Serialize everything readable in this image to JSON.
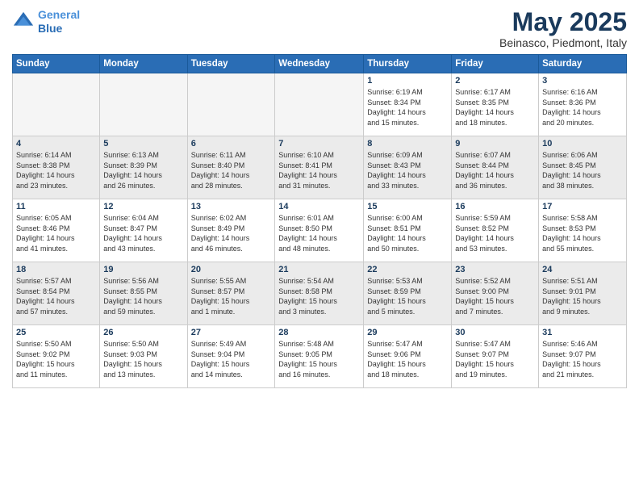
{
  "header": {
    "logo_line1": "General",
    "logo_line2": "Blue",
    "title": "May 2025",
    "subtitle": "Beinasco, Piedmont, Italy"
  },
  "weekdays": [
    "Sunday",
    "Monday",
    "Tuesday",
    "Wednesday",
    "Thursday",
    "Friday",
    "Saturday"
  ],
  "weeks": [
    [
      {
        "day": "",
        "info": "",
        "empty": true
      },
      {
        "day": "",
        "info": "",
        "empty": true
      },
      {
        "day": "",
        "info": "",
        "empty": true
      },
      {
        "day": "",
        "info": "",
        "empty": true
      },
      {
        "day": "1",
        "info": "Sunrise: 6:19 AM\nSunset: 8:34 PM\nDaylight: 14 hours\nand 15 minutes."
      },
      {
        "day": "2",
        "info": "Sunrise: 6:17 AM\nSunset: 8:35 PM\nDaylight: 14 hours\nand 18 minutes."
      },
      {
        "day": "3",
        "info": "Sunrise: 6:16 AM\nSunset: 8:36 PM\nDaylight: 14 hours\nand 20 minutes."
      }
    ],
    [
      {
        "day": "4",
        "info": "Sunrise: 6:14 AM\nSunset: 8:38 PM\nDaylight: 14 hours\nand 23 minutes."
      },
      {
        "day": "5",
        "info": "Sunrise: 6:13 AM\nSunset: 8:39 PM\nDaylight: 14 hours\nand 26 minutes."
      },
      {
        "day": "6",
        "info": "Sunrise: 6:11 AM\nSunset: 8:40 PM\nDaylight: 14 hours\nand 28 minutes."
      },
      {
        "day": "7",
        "info": "Sunrise: 6:10 AM\nSunset: 8:41 PM\nDaylight: 14 hours\nand 31 minutes."
      },
      {
        "day": "8",
        "info": "Sunrise: 6:09 AM\nSunset: 8:43 PM\nDaylight: 14 hours\nand 33 minutes."
      },
      {
        "day": "9",
        "info": "Sunrise: 6:07 AM\nSunset: 8:44 PM\nDaylight: 14 hours\nand 36 minutes."
      },
      {
        "day": "10",
        "info": "Sunrise: 6:06 AM\nSunset: 8:45 PM\nDaylight: 14 hours\nand 38 minutes."
      }
    ],
    [
      {
        "day": "11",
        "info": "Sunrise: 6:05 AM\nSunset: 8:46 PM\nDaylight: 14 hours\nand 41 minutes."
      },
      {
        "day": "12",
        "info": "Sunrise: 6:04 AM\nSunset: 8:47 PM\nDaylight: 14 hours\nand 43 minutes."
      },
      {
        "day": "13",
        "info": "Sunrise: 6:02 AM\nSunset: 8:49 PM\nDaylight: 14 hours\nand 46 minutes."
      },
      {
        "day": "14",
        "info": "Sunrise: 6:01 AM\nSunset: 8:50 PM\nDaylight: 14 hours\nand 48 minutes."
      },
      {
        "day": "15",
        "info": "Sunrise: 6:00 AM\nSunset: 8:51 PM\nDaylight: 14 hours\nand 50 minutes."
      },
      {
        "day": "16",
        "info": "Sunrise: 5:59 AM\nSunset: 8:52 PM\nDaylight: 14 hours\nand 53 minutes."
      },
      {
        "day": "17",
        "info": "Sunrise: 5:58 AM\nSunset: 8:53 PM\nDaylight: 14 hours\nand 55 minutes."
      }
    ],
    [
      {
        "day": "18",
        "info": "Sunrise: 5:57 AM\nSunset: 8:54 PM\nDaylight: 14 hours\nand 57 minutes."
      },
      {
        "day": "19",
        "info": "Sunrise: 5:56 AM\nSunset: 8:55 PM\nDaylight: 14 hours\nand 59 minutes."
      },
      {
        "day": "20",
        "info": "Sunrise: 5:55 AM\nSunset: 8:57 PM\nDaylight: 15 hours\nand 1 minute."
      },
      {
        "day": "21",
        "info": "Sunrise: 5:54 AM\nSunset: 8:58 PM\nDaylight: 15 hours\nand 3 minutes."
      },
      {
        "day": "22",
        "info": "Sunrise: 5:53 AM\nSunset: 8:59 PM\nDaylight: 15 hours\nand 5 minutes."
      },
      {
        "day": "23",
        "info": "Sunrise: 5:52 AM\nSunset: 9:00 PM\nDaylight: 15 hours\nand 7 minutes."
      },
      {
        "day": "24",
        "info": "Sunrise: 5:51 AM\nSunset: 9:01 PM\nDaylight: 15 hours\nand 9 minutes."
      }
    ],
    [
      {
        "day": "25",
        "info": "Sunrise: 5:50 AM\nSunset: 9:02 PM\nDaylight: 15 hours\nand 11 minutes."
      },
      {
        "day": "26",
        "info": "Sunrise: 5:50 AM\nSunset: 9:03 PM\nDaylight: 15 hours\nand 13 minutes."
      },
      {
        "day": "27",
        "info": "Sunrise: 5:49 AM\nSunset: 9:04 PM\nDaylight: 15 hours\nand 14 minutes."
      },
      {
        "day": "28",
        "info": "Sunrise: 5:48 AM\nSunset: 9:05 PM\nDaylight: 15 hours\nand 16 minutes."
      },
      {
        "day": "29",
        "info": "Sunrise: 5:47 AM\nSunset: 9:06 PM\nDaylight: 15 hours\nand 18 minutes."
      },
      {
        "day": "30",
        "info": "Sunrise: 5:47 AM\nSunset: 9:07 PM\nDaylight: 15 hours\nand 19 minutes."
      },
      {
        "day": "31",
        "info": "Sunrise: 5:46 AM\nSunset: 9:07 PM\nDaylight: 15 hours\nand 21 minutes."
      }
    ]
  ]
}
